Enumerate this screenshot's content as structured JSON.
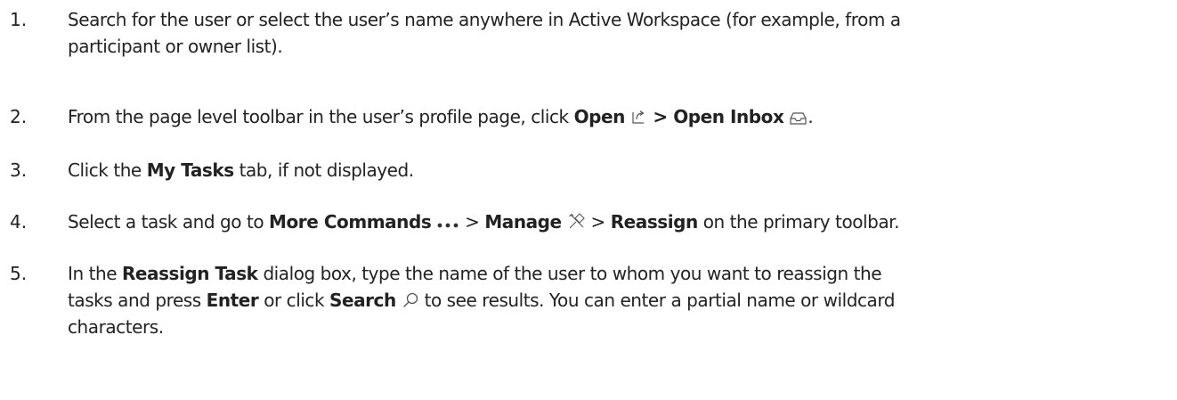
{
  "steps": [
    {
      "number": "1.",
      "line1": "Search for the user or select the user’s name anywhere in Active Workspace (for example, from a",
      "line2": "participant or owner list)."
    },
    {
      "number": "2.",
      "pre": "From the page level toolbar in the user’s profile page, click ",
      "open_label": "Open",
      "open_icon": "open-icon",
      "sep": " > ",
      "open_inbox_label": "Open Inbox",
      "inbox_icon": "inbox-icon",
      "post": "."
    },
    {
      "number": "3.",
      "pre": "Click the ",
      "tab_label": "My Tasks",
      "post": " tab, if not displayed."
    },
    {
      "number": "4.",
      "pre": "Select a task and go to ",
      "more_commands_label": "More Commands",
      "more_icon": "more-commands-icon",
      "sep1": " > ",
      "manage_label": "Manage",
      "manage_icon": "manage-icon",
      "sep2": " > ",
      "reassign_label": "Reassign",
      "post": " on the primary toolbar."
    },
    {
      "number": "5.",
      "pre1": "In the ",
      "dialog_label": "Reassign Task",
      "post1": " dialog box, type the name of the user to whom you want to reassign the",
      "pre2": "tasks and press ",
      "enter_label": "Enter",
      "mid2": " or click ",
      "search_label": "Search",
      "search_icon": "search-icon",
      "post2": " to see results. You can enter a partial name or wildcard",
      "line3": "characters."
    }
  ]
}
